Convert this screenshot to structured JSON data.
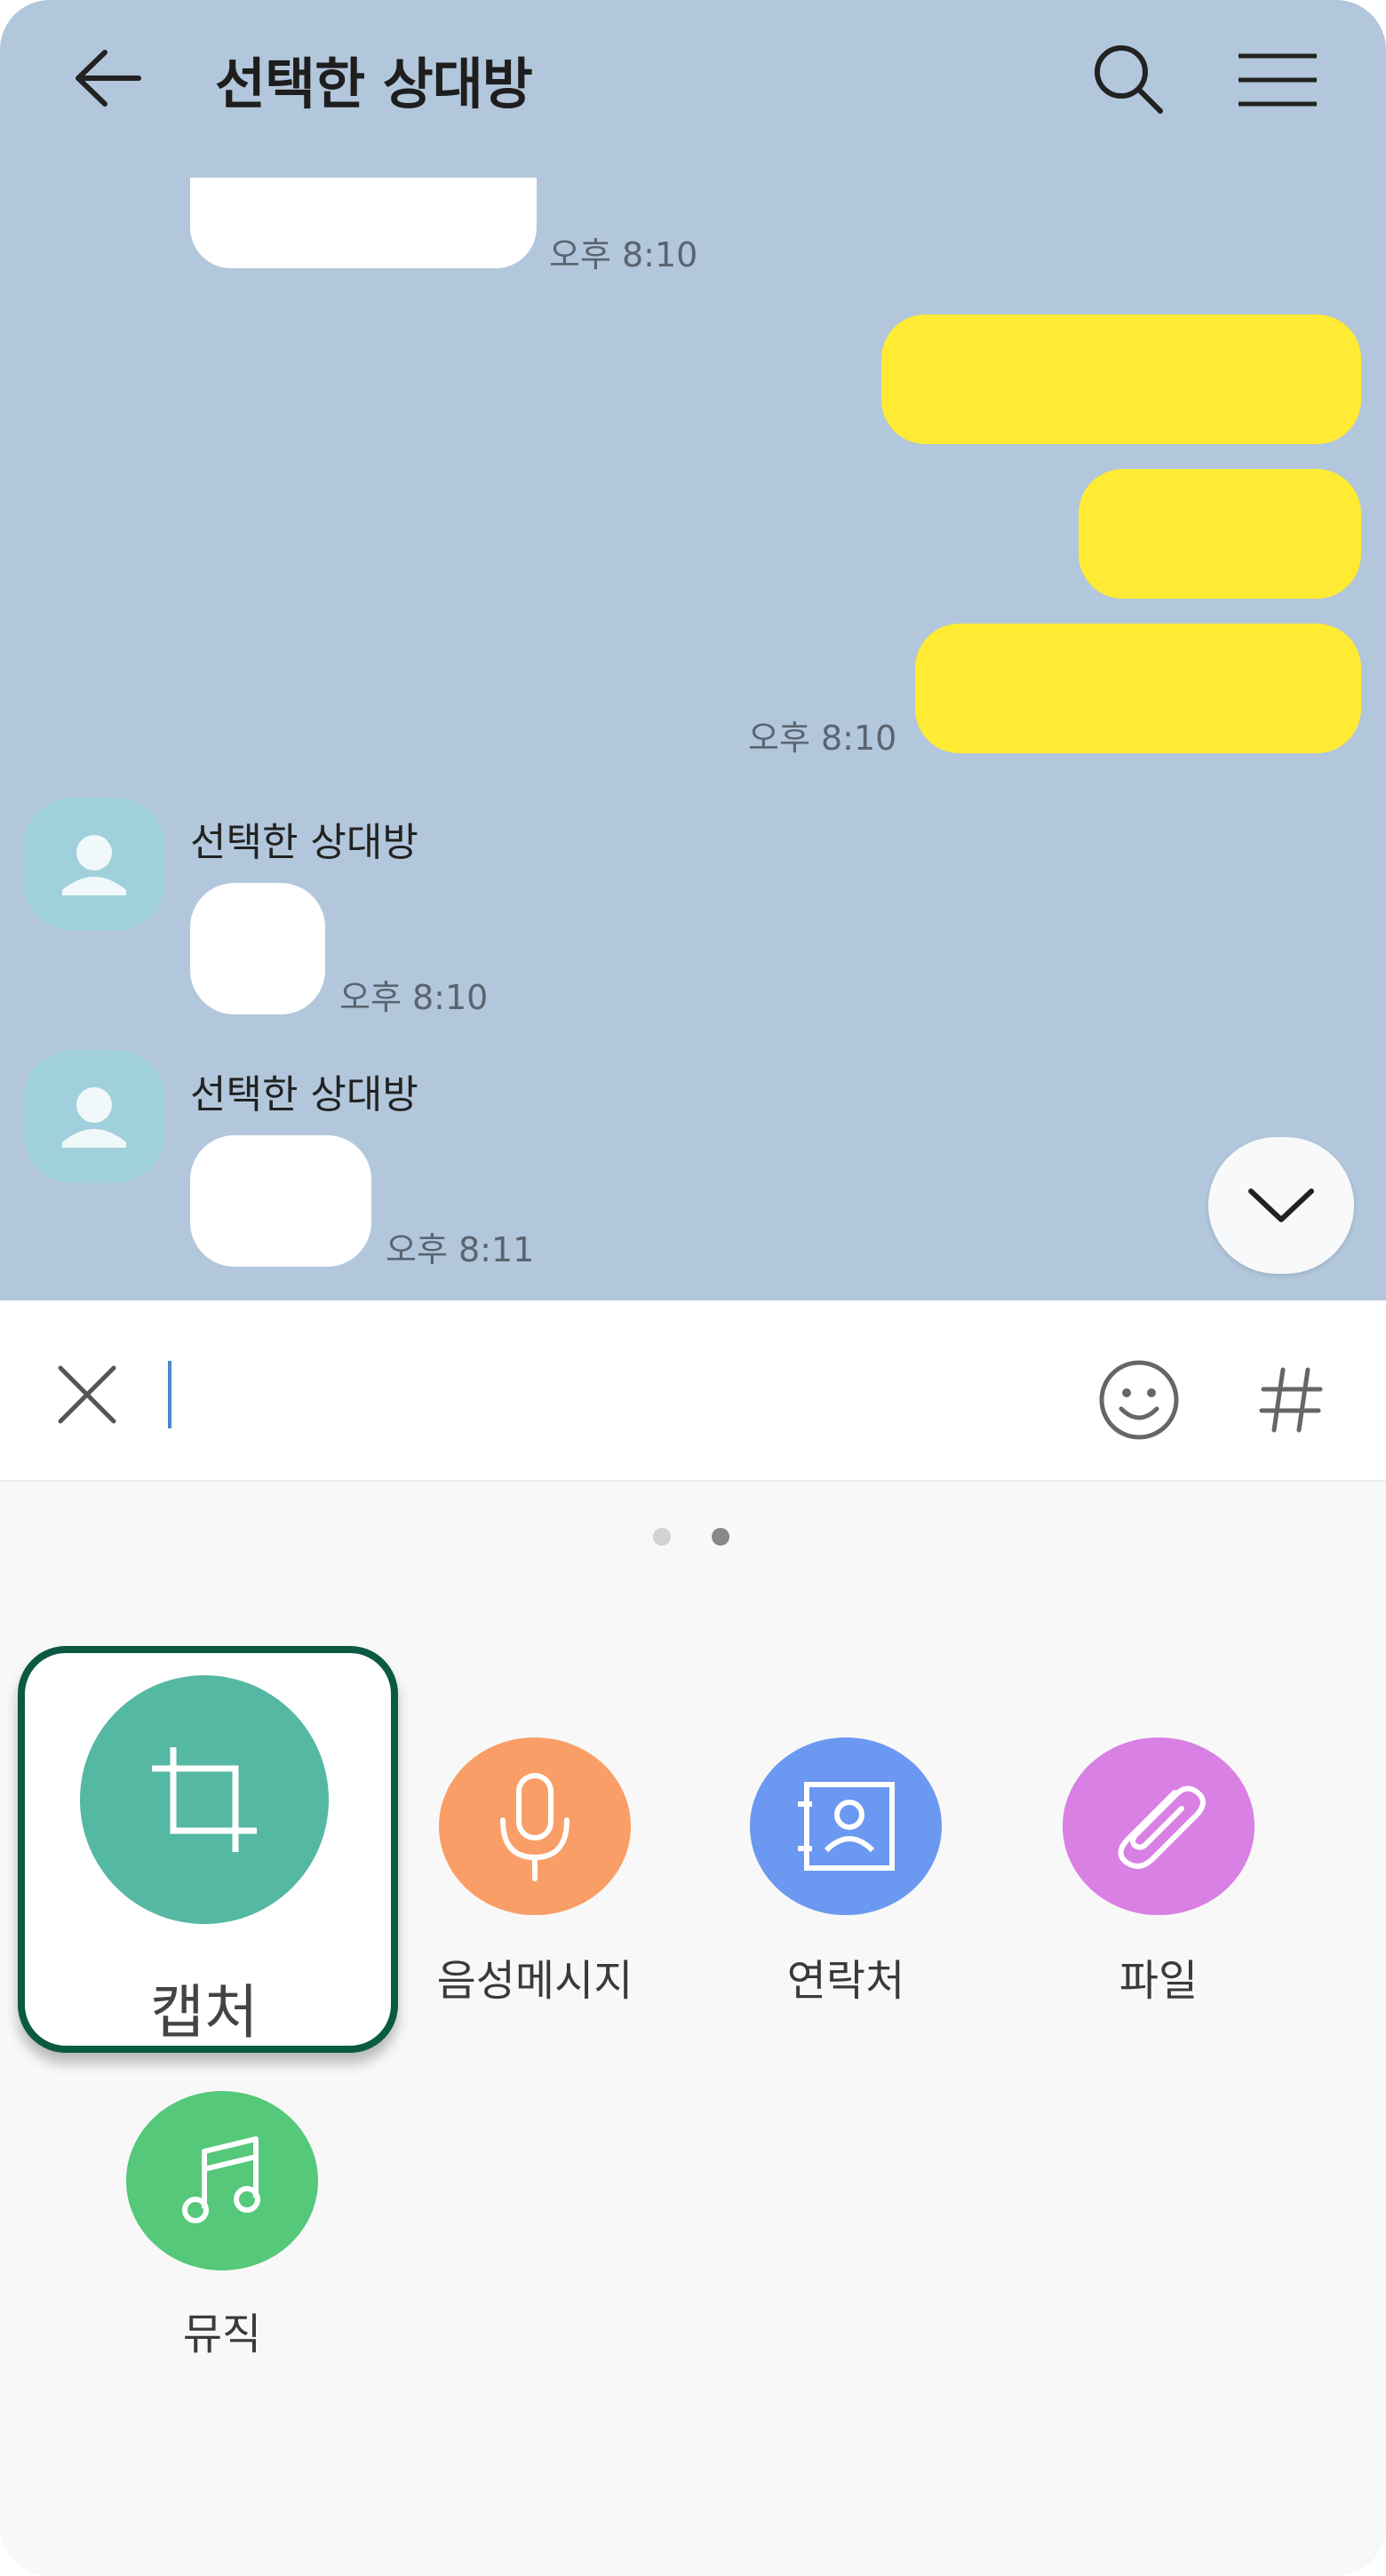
{
  "header": {
    "title": "선택한 상대방",
    "back_icon": "arrow-left-icon",
    "search_icon": "search-icon",
    "menu_icon": "hamburger-menu-icon"
  },
  "messages": {
    "incoming_first_time": "오후 8:10",
    "outgoing_time": "오후 8:10",
    "incoming_2": {
      "sender": "선택한 상대방",
      "time": "오후 8:10"
    },
    "incoming_3": {
      "sender": "선택한 상대방",
      "time": "오후 8:11"
    }
  },
  "input": {
    "value": "",
    "close_icon": "close-icon",
    "emoji_icon": "smiley-icon",
    "hashtag_icon": "hashtag-icon"
  },
  "attach_menu": {
    "items": [
      {
        "label": "캡처",
        "icon": "crop-icon",
        "color": "#55b8a2"
      },
      {
        "label": "음성메시지",
        "icon": "microphone-icon",
        "color": "#f99e66"
      },
      {
        "label": "연락처",
        "icon": "contact-book-icon",
        "color": "#6b98f0"
      },
      {
        "label": "파일",
        "icon": "paperclip-icon",
        "color": "#d980e4"
      },
      {
        "label": "뮤직",
        "icon": "music-note-icon",
        "color": "#55c87a"
      }
    ]
  },
  "colors": {
    "chat_background": "#b2c7db",
    "my_bubble": "#ffeb33",
    "highlight_border": "#0b5a43"
  }
}
